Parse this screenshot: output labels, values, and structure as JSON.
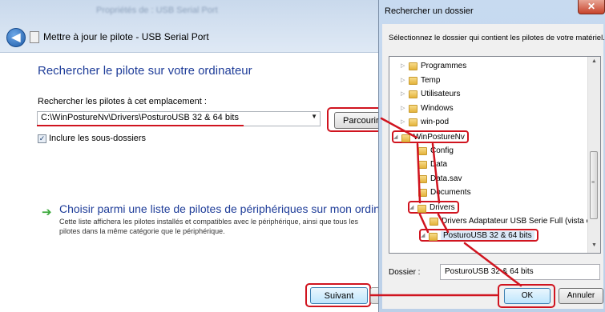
{
  "wizard": {
    "blurred_title": "Propriétés de : USB Serial Port",
    "window_title": "Mettre à jour le pilote - USB Serial Port",
    "heading": "Rechercher le pilote sur votre ordinateur",
    "location_label": "Rechercher les pilotes à cet emplacement :",
    "path_value": "C:\\WinPostureNv\\Drivers\\PosturoUSB 32 & 64 bits",
    "browse_label": "Parcourir...",
    "include_subfolders_label": "Inclure les sous-dossiers",
    "include_subfolders_checked": true,
    "pick_heading": "Choisir parmi une liste de pilotes de périphériques sur mon ordinateur",
    "pick_description": "Cette liste affichera les pilotes installés et compatibles avec le périphérique, ainsi que tous les pilotes dans la même catégorie que le périphérique.",
    "next_label": "Suivant"
  },
  "folder_dialog": {
    "title": "Rechercher un dossier",
    "close_glyph": "✕",
    "instruction": "Sélectionnez le dossier qui contient les pilotes de votre matériel.",
    "tree": [
      {
        "label": "Programmes",
        "expander": "▷"
      },
      {
        "label": "Temp",
        "expander": "▷"
      },
      {
        "label": "Utilisateurs",
        "expander": "▷"
      },
      {
        "label": "Windows",
        "expander": "▷"
      },
      {
        "label": "win-pod",
        "expander": "▷"
      },
      {
        "label": "WinPostureNv",
        "expander": "◢",
        "highlighted": true
      },
      {
        "label": "Config",
        "expander": ""
      },
      {
        "label": "Data",
        "expander": ""
      },
      {
        "label": "Data.sav",
        "expander": ""
      },
      {
        "label": "Documents",
        "expander": ""
      },
      {
        "label": "Drivers",
        "expander": "◢",
        "highlighted": true
      },
      {
        "label": "Drivers Adaptateur USB Serie Full (vista ok)",
        "expander": ""
      },
      {
        "label": "PosturoUSB 32 & 64 bits",
        "expander": "◢",
        "highlighted": true,
        "selected": true
      }
    ],
    "folder_label": "Dossier :",
    "folder_value": "PosturoUSB 32 & 64 bits",
    "ok_label": "OK",
    "cancel_label": "Annuler"
  },
  "colors": {
    "annotation_red": "#d0141f",
    "heading_blue": "#1f3d99",
    "dialog_frame": "#c7daf0"
  },
  "icons": {
    "back": "back-arrow-icon",
    "folder": "folder-icon",
    "next_arrow": "green-arrow-icon",
    "close": "close-icon"
  }
}
